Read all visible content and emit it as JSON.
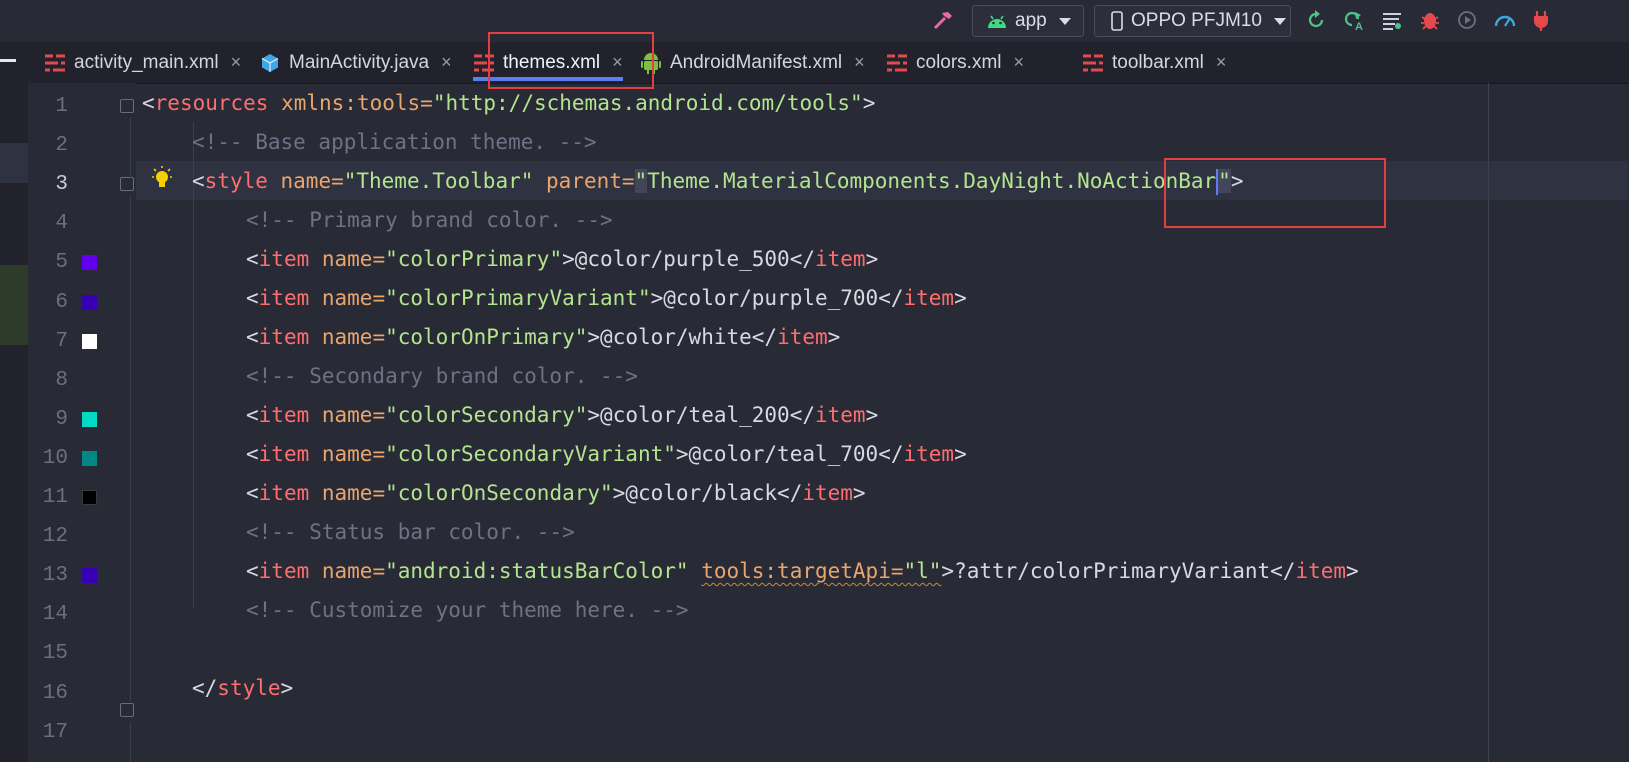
{
  "toolbar": {
    "build_icon": "hammer-icon",
    "run_config": "app",
    "device": "OPPO PFJM10",
    "actions": [
      "rerun-icon",
      "apply-changes-icon",
      "logcat-icon",
      "debug-icon",
      "attach-debugger-icon",
      "profiler-icon",
      "power-icon"
    ]
  },
  "tabs": [
    {
      "label": "activity_main.xml",
      "icon": "layout-xml-icon",
      "active": false
    },
    {
      "label": "MainActivity.java",
      "icon": "java-class-icon",
      "active": false
    },
    {
      "label": "themes.xml",
      "icon": "layout-xml-icon",
      "active": true
    },
    {
      "label": "AndroidManifest.xml",
      "icon": "android-icon",
      "active": false
    },
    {
      "label": "colors.xml",
      "icon": "layout-xml-icon",
      "active": false
    },
    {
      "label": "toolbar.xml",
      "icon": "layout-xml-icon",
      "active": false
    }
  ],
  "tab_close_glyph": "×",
  "gutter": {
    "line_numbers": [
      "1",
      "2",
      "3",
      "4",
      "5",
      "6",
      "7",
      "8",
      "9",
      "10",
      "11",
      "12",
      "13",
      "14",
      "15",
      "16",
      "17"
    ],
    "swatch_colors": {
      "5": "#6200ee",
      "6": "#3700b3",
      "7": "#ffffff",
      "9": "#03dac5",
      "10": "#018786",
      "11": "#000000",
      "13": "#3700b3"
    }
  },
  "code": {
    "l1": {
      "lt": "<",
      "tag": "resources",
      "attr": " xmlns:tools=",
      "val": "\"http://schemas.android.com/tools\"",
      "gt": ">"
    },
    "l2": "<!-- Base application theme. -->",
    "l3": {
      "lt": "<",
      "tag": "style",
      "a1": " name=",
      "v1": "\"Theme.Toolbar\"",
      "a2": " parent=",
      "q1": "\"",
      "v2a": "Theme.MaterialComponents.DayNight",
      "v2b": ".NoActionBar",
      "q2": "\"",
      "gt": ">"
    },
    "l4": "<!-- Primary brand color. -->",
    "l5": {
      "name": "\"colorPrimary\"",
      "value": "@color/purple_500"
    },
    "l6": {
      "name": "\"colorPrimaryVariant\"",
      "value": "@color/purple_700"
    },
    "l7": {
      "name": "\"colorOnPrimary\"",
      "value": "@color/white"
    },
    "l8": "<!-- Secondary brand color. -->",
    "l9": {
      "name": "\"colorSecondary\"",
      "value": "@color/teal_200"
    },
    "l10": {
      "name": "\"colorSecondaryVariant\"",
      "value": "@color/teal_700"
    },
    "l11": {
      "name": "\"colorOnSecondary\"",
      "value": "@color/black"
    },
    "l12": "<!-- Status bar color. -->",
    "l13": {
      "name": "\"android:statusBarColor\"",
      "tools_attr": "tools:targetApi=",
      "tools_val": "\"l\"",
      "value": "?attr/colorPrimaryVariant"
    },
    "l14": "<!-- Customize your theme here. -->",
    "l16": {
      "lt": "</",
      "tag": "style",
      "gt": ">"
    },
    "item_tag": "item",
    "name_attr": " name=",
    "open_lt": "<",
    "close_lt": "</",
    "gt": ">"
  },
  "colors": {
    "tag": "#ff6e6e",
    "attribute": "#e9a56c",
    "string": "#b3e48e",
    "comment": "#6e7284",
    "highlight_box": "#e04040",
    "caret": "#5d7df5"
  }
}
